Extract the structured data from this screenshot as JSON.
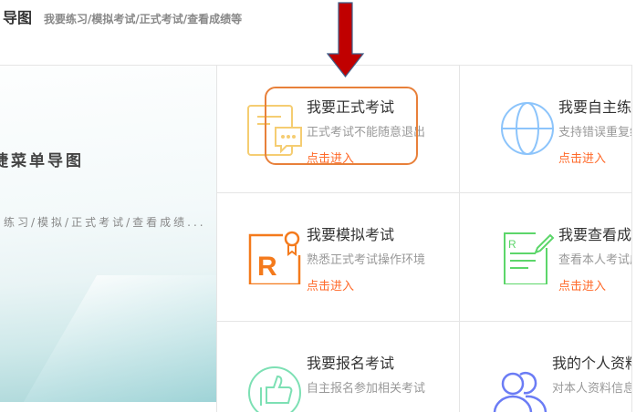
{
  "header": {
    "title": "导图",
    "subtitle": "我要练习/模拟考试/正式考试/查看成绩等"
  },
  "left_panel": {
    "title": "捷菜单导图",
    "subtitle": "练习/模拟/正式考试/查看成绩..."
  },
  "cards": [
    {
      "title": "我要正式考试",
      "desc": "正式考试不能随意退出",
      "link": "点击进入"
    },
    {
      "title": "我要自主练习",
      "desc": "支持错误重复练习",
      "link": "点击进入"
    },
    {
      "title": "我要模拟考试",
      "desc": "熟悉正式考试操作环境",
      "link": "点击进入"
    },
    {
      "title": "我要查看成绩",
      "desc": "查看本人考试成绩",
      "link": "点击进入"
    },
    {
      "title": "我要报名考试",
      "desc": "自主报名参加相关考试"
    },
    {
      "title": "我的个人资料",
      "desc": "对本人资料信息"
    }
  ],
  "colors": {
    "accent": "#ff6a2a",
    "arrow": "#c00000",
    "highlight": "#e8803a"
  }
}
